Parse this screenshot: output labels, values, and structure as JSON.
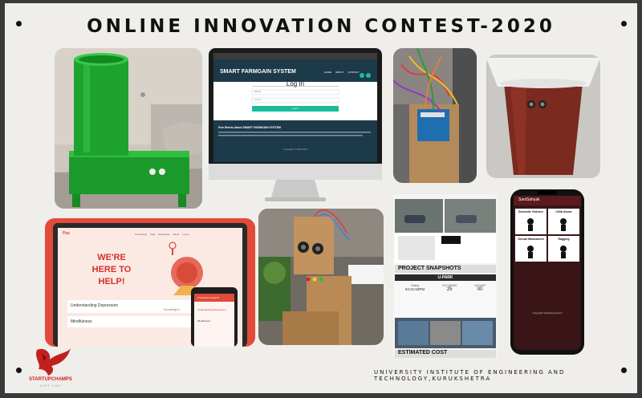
{
  "title": "ONLINE INNOVATION CONTEST-2020",
  "footer": "UNIVERSITY INSTITUTE OF ENGINEERING AND TECHNOLOGY,KURUKSHETRA",
  "logo": {
    "name": "STARTUPCHAMPS",
    "sub": "UIET KUK"
  },
  "monitor": {
    "brand": "SMART FARMGAIN SYSTEM",
    "nav": [
      "HOME",
      "ABOUT",
      "CONTACT"
    ],
    "heading": "Log In",
    "user_value": "farmer",
    "pass_value": "••••••••",
    "button": "Log In",
    "about_title": "Few Words About SMART FARMGAIN SYSTEM",
    "copyright": "Copyright © 2020 SFS"
  },
  "laptop": {
    "logo": "Pax",
    "headline": [
      "WE'RE",
      "HERE TO",
      "HELP!"
    ],
    "nav": [
      "Community",
      "FAQ",
      "Resources",
      "About",
      "Log In"
    ],
    "card1": "Understanding Depression",
    "card1_sub": "Knowledge b",
    "card2": "Mindfulness"
  },
  "laptop_phone": {
    "header": "Professional support",
    "item1": "Understanding Depression",
    "item2": "Mindfulness"
  },
  "phone": {
    "app_title": "SaniSahyak",
    "tiles": [
      "Domestic Violence",
      "Child Abuse",
      "Sexual Harassment",
      "Ragging"
    ],
    "copyright": "Copyright ©Ganjing System"
  },
  "snapshots": {
    "label1": "PROJECT SNAPSHOTS",
    "app": "U-PARK",
    "stat_labels": [
      "Timing",
      "OCCUPIED",
      "VACANT"
    ],
    "stat_values": [
      "04:41:53PM",
      "25",
      "00"
    ],
    "label2": "ESTIMATED COST"
  }
}
